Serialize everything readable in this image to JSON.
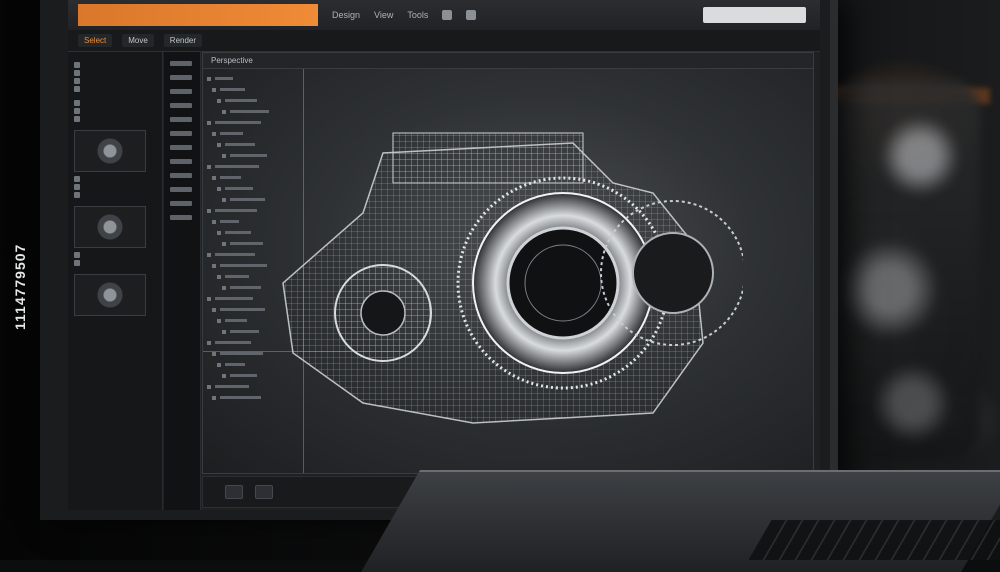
{
  "menubar": {
    "brand": "",
    "brand_sub": "",
    "items": [
      "Design",
      "View",
      "Tools"
    ],
    "search_placeholder": ""
  },
  "toolbar": {
    "buttons": [
      "Select",
      "Move",
      "Render"
    ],
    "path": ""
  },
  "viewport": {
    "header": "Perspective"
  },
  "statusbar": {
    "label": ""
  },
  "watermark_id": "1114779507",
  "colors": {
    "accent": "#f08b36",
    "panel": "#1e2022",
    "viewport": "#3a3d40"
  }
}
